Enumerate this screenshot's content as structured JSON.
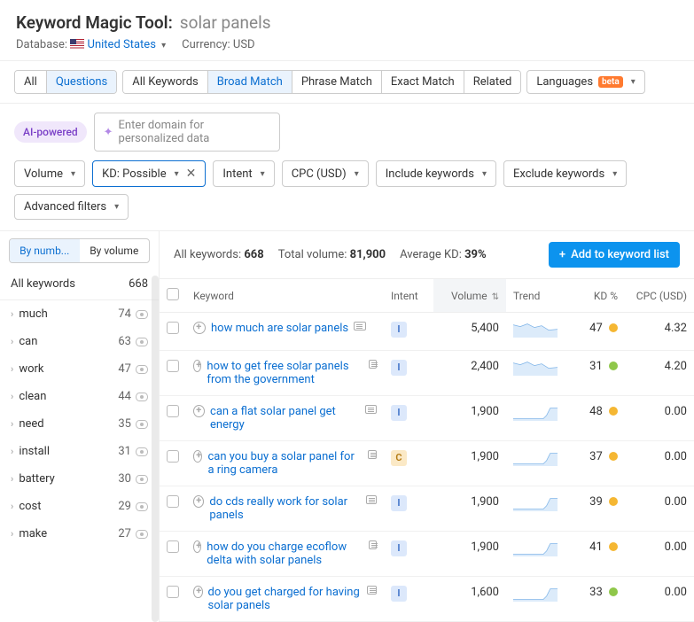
{
  "header": {
    "tool_name": "Keyword Magic Tool:",
    "search_term": "solar panels",
    "database_label": "Database:",
    "database_value": "United States",
    "currency_label": "Currency:",
    "currency_value": "USD"
  },
  "tabs": {
    "scope": [
      "All",
      "Questions"
    ],
    "scope_active": "Questions",
    "match": [
      "All Keywords",
      "Broad Match",
      "Phrase Match",
      "Exact Match",
      "Related"
    ],
    "match_active": "Broad Match",
    "languages_label": "Languages",
    "beta_label": "beta"
  },
  "ai": {
    "badge": "AI-powered",
    "placeholder": "Enter domain for personalized data"
  },
  "filters": {
    "volume": "Volume",
    "kd": "KD: Possible",
    "intent": "Intent",
    "cpc": "CPC (USD)",
    "include": "Include keywords",
    "exclude": "Exclude keywords",
    "advanced": "Advanced filters"
  },
  "sidebar": {
    "toggle": {
      "numb": "By numb...",
      "volume": "By volume"
    },
    "all_label": "All keywords",
    "all_count": "668",
    "items": [
      {
        "label": "much",
        "count": "74"
      },
      {
        "label": "can",
        "count": "63"
      },
      {
        "label": "work",
        "count": "47"
      },
      {
        "label": "clean",
        "count": "44"
      },
      {
        "label": "need",
        "count": "35"
      },
      {
        "label": "install",
        "count": "31"
      },
      {
        "label": "battery",
        "count": "30"
      },
      {
        "label": "cost",
        "count": "29"
      },
      {
        "label": "make",
        "count": "27"
      }
    ]
  },
  "summary": {
    "all_keywords_label": "All keywords:",
    "all_keywords": "668",
    "total_volume_label": "Total volume:",
    "total_volume": "81,900",
    "avg_kd_label": "Average KD:",
    "avg_kd": "39%",
    "add_button": "Add to keyword list"
  },
  "columns": {
    "keyword": "Keyword",
    "intent": "Intent",
    "volume": "Volume",
    "trend": "Trend",
    "kd": "KD %",
    "cpc": "CPC (USD)"
  },
  "rows": [
    {
      "keyword": "how much are solar panels",
      "intent": "I",
      "volume": "5,400",
      "kd": "47",
      "kd_color": "y",
      "cpc": "4.32",
      "trend": "down"
    },
    {
      "keyword": "how to get free solar panels from the government",
      "intent": "I",
      "volume": "2,400",
      "kd": "31",
      "kd_color": "g",
      "cpc": "4.20",
      "trend": "down"
    },
    {
      "keyword": "can a flat solar panel get energy",
      "intent": "I",
      "volume": "1,900",
      "kd": "48",
      "kd_color": "y",
      "cpc": "0.00",
      "trend": "up"
    },
    {
      "keyword": "can you buy a solar panel for a ring camera",
      "intent": "C",
      "volume": "1,900",
      "kd": "37",
      "kd_color": "y",
      "cpc": "0.00",
      "trend": "up"
    },
    {
      "keyword": "do cds really work for solar panels",
      "intent": "I",
      "volume": "1,900",
      "kd": "39",
      "kd_color": "y",
      "cpc": "0.00",
      "trend": "up"
    },
    {
      "keyword": "how do you charge ecoflow delta with solar panels",
      "intent": "I",
      "volume": "1,900",
      "kd": "41",
      "kd_color": "y",
      "cpc": "0.00",
      "trend": "up"
    },
    {
      "keyword": "do you get charged for having solar panels",
      "intent": "I",
      "volume": "1,600",
      "kd": "33",
      "kd_color": "g",
      "cpc": "0.00",
      "trend": "up"
    }
  ],
  "chart_data": {
    "type": "table",
    "title": "Keyword Magic Tool — Questions / Broad Match — solar panels",
    "columns": [
      "Keyword",
      "Intent",
      "Volume",
      "KD %",
      "CPC (USD)"
    ],
    "rows": [
      [
        "how much are solar panels",
        "I",
        5400,
        47,
        4.32
      ],
      [
        "how to get free solar panels from the government",
        "I",
        2400,
        31,
        4.2
      ],
      [
        "can a flat solar panel get energy",
        "I",
        1900,
        48,
        0.0
      ],
      [
        "can you buy a solar panel for a ring camera",
        "C",
        1900,
        37,
        0.0
      ],
      [
        "do cds really work for solar panels",
        "I",
        1900,
        39,
        0.0
      ],
      [
        "how do you charge ecoflow delta with solar panels",
        "I",
        1900,
        41,
        0.0
      ],
      [
        "do you get charged for having solar panels",
        "I",
        1600,
        33,
        0.0
      ]
    ],
    "summary": {
      "all_keywords": 668,
      "total_volume": 81900,
      "average_kd_pct": 39
    }
  }
}
